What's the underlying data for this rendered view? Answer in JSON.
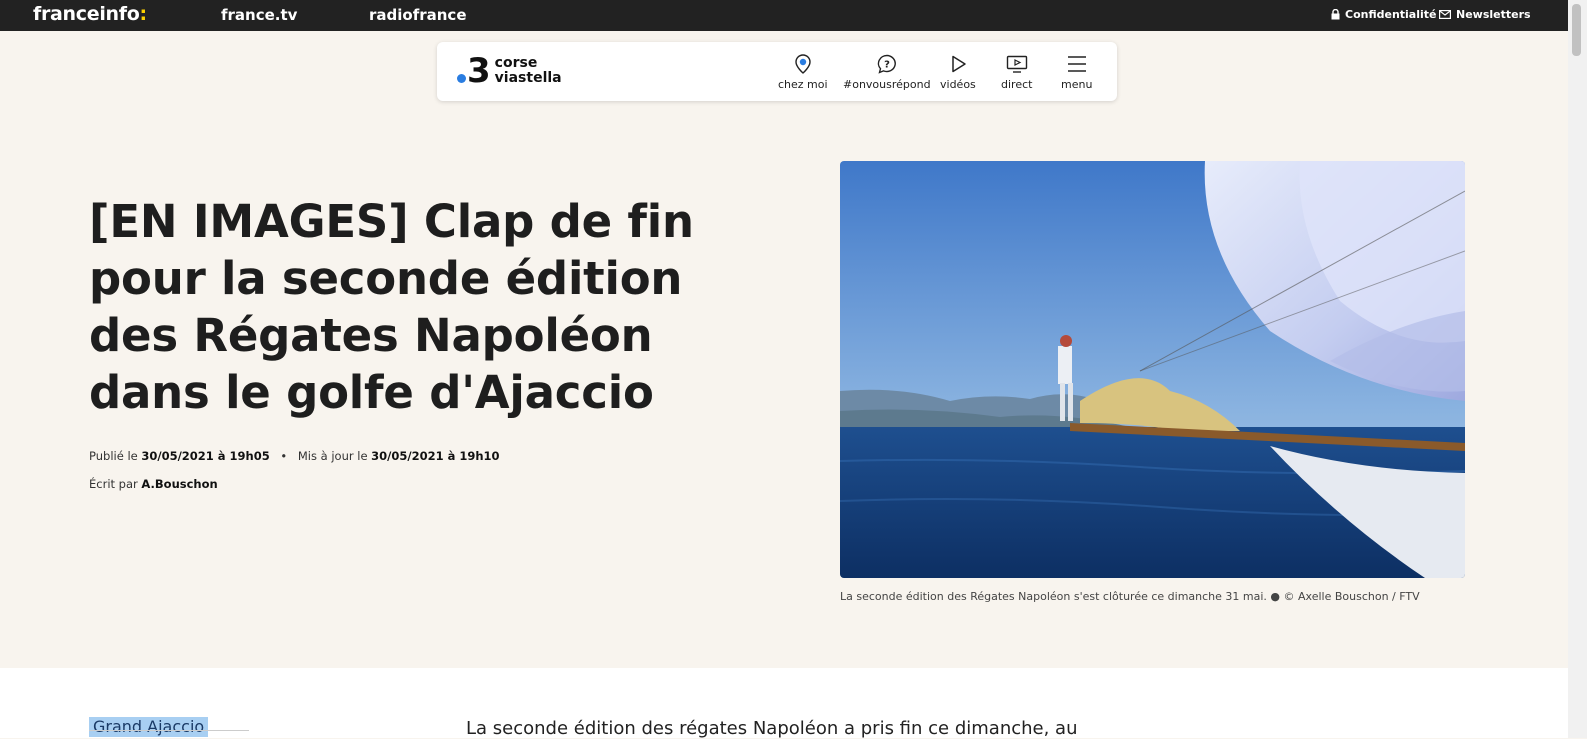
{
  "topbar": {
    "brand": "franceinfo",
    "brand_colon": ":",
    "links": [
      "france.tv",
      "radiofrance"
    ],
    "privacy": "Confidentialité",
    "newsletters": "Newsletters"
  },
  "header": {
    "logo_number": "3",
    "logo_line1": "corse",
    "logo_line2": "viastella",
    "nav": {
      "home": "chez moi",
      "answers": "#onvousrépond",
      "videos": "vidéos",
      "live": "direct",
      "menu": "menu"
    }
  },
  "article": {
    "title": "[EN IMAGES] Clap de fin pour la seconde édition des Régates Napoléon dans le golfe d'Ajaccio",
    "published_label": "Publié le",
    "published_date": "30/05/2021 à 19h05",
    "separator": "•",
    "updated_label": "Mis à jour le",
    "updated_date": "30/05/2021 à 19h10",
    "author_label": "Écrit par",
    "author": "A.Bouschon",
    "caption": "La seconde édition des Régates Napoléon s'est clôturée ce dimanche 31 mai. ● © Axelle Bouschon / FTV",
    "tag": "Grand Ajaccio",
    "intro": "La seconde édition des régates Napoléon a pris fin ce dimanche, au"
  },
  "colors": {
    "topbar_bg": "#222222",
    "page_bg": "#f8f4ee",
    "accent_yellow": "#fdd100",
    "logo_blue": "#2a7de1",
    "tag_highlight": "#a8cff2"
  }
}
